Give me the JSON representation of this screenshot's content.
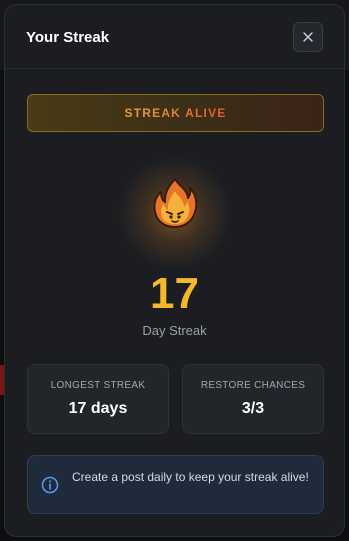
{
  "modal": {
    "title": "Your Streak",
    "close_icon": "close-icon"
  },
  "banner": {
    "label": "STREAK ALIVE"
  },
  "streak": {
    "icon": "flame-icon",
    "count": "17",
    "label": "Day Streak"
  },
  "stats": [
    {
      "label": "LONGEST STREAK",
      "value": "17 days"
    },
    {
      "label": "RESTORE CHANCES",
      "value": "3/3"
    }
  ],
  "info": {
    "icon": "info-icon",
    "text": "Create a post daily to keep your streak alive!"
  },
  "colors": {
    "accent": "#f5b82a",
    "banner_text_start": "#e8a33a",
    "banner_text_end": "#e05a2a",
    "info_bg": "#1f2a3b"
  }
}
